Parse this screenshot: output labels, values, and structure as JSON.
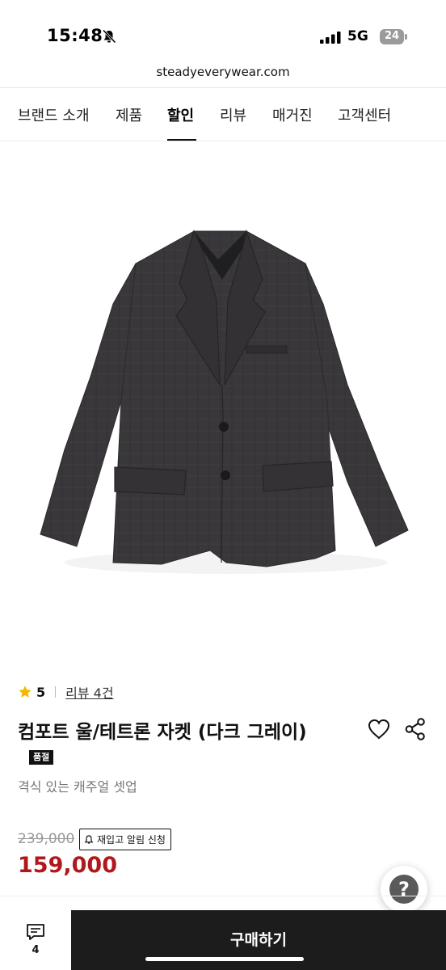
{
  "status_bar": {
    "time": "15:48",
    "network": "5G",
    "battery": "24"
  },
  "browser": {
    "url": "steadyeverywear.com"
  },
  "nav": {
    "items": [
      "브랜드 소개",
      "제품",
      "할인",
      "리뷰",
      "매거진",
      "고객센터"
    ],
    "active": "할인"
  },
  "product": {
    "rating": "5",
    "review_link": "리뷰 4건",
    "title": "컴포트 울/테트론 자켓 (다크 그레이)",
    "badge": "품절",
    "subtitle": "격식 있는 캐주얼 셋업",
    "original_price": "239,000",
    "restock_button": "재입고 알림 신청",
    "sale_price": "159,000",
    "image": {
      "subject": "dark grey blazer",
      "color": "#3a383b"
    }
  },
  "help_button": {
    "label": "?"
  },
  "bottom_bar": {
    "comment_count": "4",
    "buy_label": "구매하기"
  },
  "colors": {
    "accent_price": "#b0181d",
    "buy_button": "#1c1c1c",
    "star": "#f5b800"
  },
  "icons": [
    "mute-icon",
    "signal-icon",
    "star-icon",
    "heart-icon",
    "share-icon",
    "bell-icon",
    "comment-icon",
    "help-icon"
  ]
}
